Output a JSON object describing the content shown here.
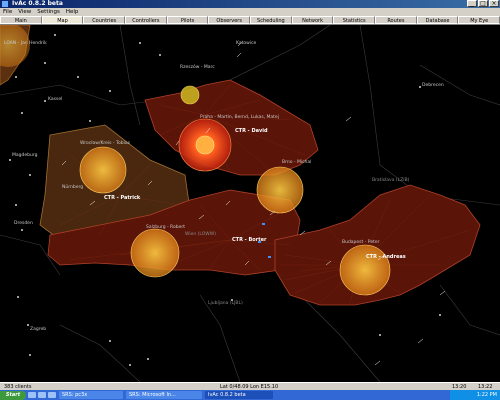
{
  "window": {
    "title": "IvAc 0.8.2 beta"
  },
  "menu": [
    "File",
    "View",
    "Settings",
    "Help"
  ],
  "tabs": [
    "Main",
    "Map",
    "Countries",
    "Controllers",
    "Pilots",
    "Observers",
    "Scheduling",
    "Network",
    "Statistics",
    "Routes",
    "Database",
    "My Eye"
  ],
  "map": {
    "controllers": [
      {
        "label": "CTR - David"
      },
      {
        "label": "CTR - Patrick"
      },
      {
        "label": "CTR - Borter"
      },
      {
        "label": "CTR - Andreas"
      }
    ],
    "labels": [
      "LOAN - Jan Hendrik",
      "Wrocław/Kreis - Tobias",
      "Praha - Martin, Bernd, Lukas, Matej",
      "Brno - Michal",
      "Salzburg - Robert",
      "Budapest - Peter",
      "Rzeszów - Marc",
      "Katowice",
      "Nürnberg",
      "Ljubljana (LJBL)",
      "Bratislava (LZIB)",
      "Wien (LOWW)",
      "Zagreb",
      "Debrecen",
      "Kassel",
      "Magdeburg",
      "Dresden"
    ]
  },
  "status": {
    "clients": "383 clients",
    "coords": "Lat 0/48.09 Lon E15.10",
    "time1": "13:20",
    "time2": "13:22"
  },
  "taskbar": {
    "start": "Start",
    "items": [
      "SRS: pc3x",
      "SRS: Microsoft In...",
      "IvAc 0.8.2 beta"
    ],
    "clock": "1:22 PM"
  },
  "colors": {
    "sector_fill": "#5a1408",
    "sector_stroke": "#b04028",
    "range_ring": "#f0a020",
    "approach_ring": "#ffcc40"
  }
}
